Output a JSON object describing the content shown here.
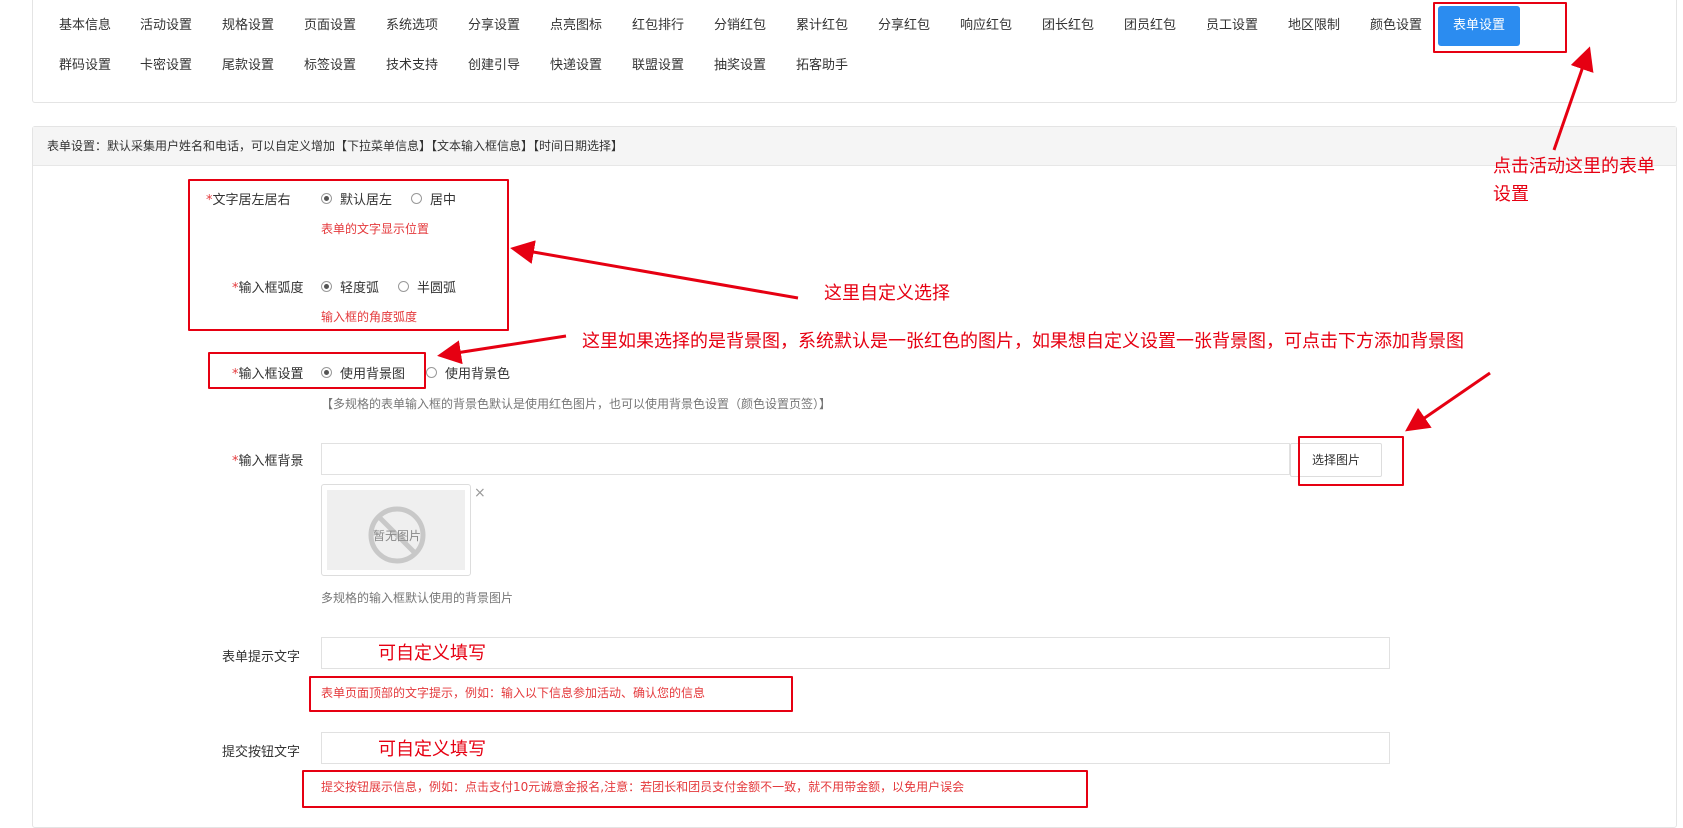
{
  "tabs": {
    "row1": [
      "基本信息",
      "活动设置",
      "规格设置",
      "页面设置",
      "系统选项",
      "分享设置",
      "点亮图标",
      "红包排行",
      "分销红包",
      "累计红包",
      "分享红包",
      "响应红包",
      "团长红包",
      "团员红包",
      "员工设置",
      "地区限制",
      "颜色设置"
    ],
    "row2": [
      "群码设置",
      "卡密设置",
      "尾款设置",
      "标签设置",
      "技术支持",
      "创建引导",
      "快递设置",
      "联盟设置",
      "抽奖设置",
      "拓客助手"
    ],
    "active": "表单设置"
  },
  "notice": "表单设置：默认采集用户姓名和电话，可以自定义增加【下拉菜单信息】【文本输入框信息】【时间日期选择】",
  "form": {
    "required_mark": "*",
    "text_align": {
      "label": "文字居左居右",
      "options": [
        "默认居左",
        "居中"
      ],
      "selected": 0,
      "help": "表单的文字显示位置"
    },
    "input_radius": {
      "label": "输入框弧度",
      "options": [
        "轻度弧",
        "半圆弧"
      ],
      "selected": 0,
      "help": "输入框的角度弧度"
    },
    "input_setting": {
      "label": "输入框设置",
      "options": [
        "使用背景图",
        "使用背景色"
      ],
      "selected": 0,
      "help": "【多规格的表单输入框的背景色默认是使用红色图片，也可以使用背景色设置（颜色设置页签）】"
    },
    "input_bg": {
      "label": "输入框背景",
      "value": "",
      "select_button": "选择图片",
      "no_image": "暂无图片",
      "close": "×",
      "help": "多规格的输入框默认使用的背景图片"
    },
    "form_tip": {
      "label": "表单提示文字",
      "value": "",
      "help": "表单页面顶部的文字提示，例如：输入以下信息参加活动、确认您的信息"
    },
    "submit_text": {
      "label": "提交按钮文字",
      "value": "",
      "help": "提交按钮展示信息，例如：点击支付10元诚意金报名,注意：若团长和团员支付金额不一致，就不用带金额，以免用户误会"
    }
  },
  "annotations": {
    "click_here": "点击活动这里的表单\n设置",
    "custom_select": "这里自定义选择",
    "bg_image_tip": "这里如果选择的是背景图，系统默认是一张红色的图片，如果想自定义设置一张背景图，可点击下方添加背景图",
    "custom_fill_1": "可自定义填写",
    "custom_fill_2": "可自定义填写"
  },
  "colors": {
    "accent": "#2b8cf0",
    "annotation_red": "#e60012",
    "help_red": "#e4393c"
  }
}
